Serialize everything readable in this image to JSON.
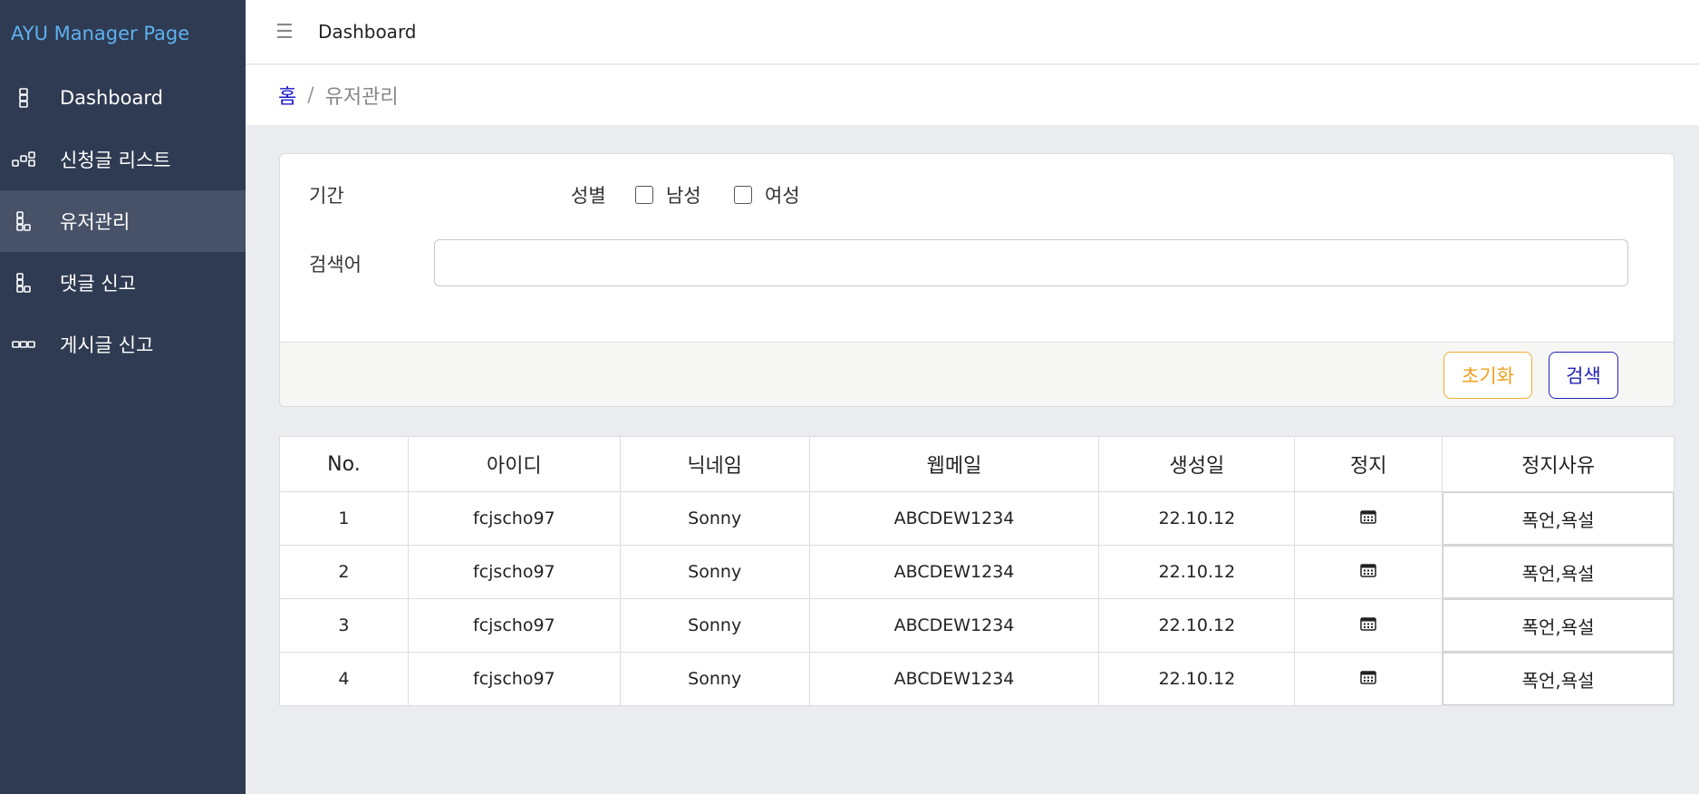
{
  "sidebar": {
    "brand": "AYU Manager Page",
    "items": [
      {
        "label": "Dashboard",
        "icon": "dashboard-icon"
      },
      {
        "label": "신청글 리스트",
        "icon": "list-icon"
      },
      {
        "label": "유저관리",
        "icon": "users-icon",
        "active": true
      },
      {
        "label": "댓글 신고",
        "icon": "report-icon"
      },
      {
        "label": "게시글 신고",
        "icon": "dots-icon"
      }
    ]
  },
  "header": {
    "title": "Dashboard",
    "menu_icon": "menu-icon"
  },
  "breadcrumb": {
    "home": "홈",
    "separator": "/",
    "current": "유저관리"
  },
  "filter": {
    "period_label": "기간",
    "gender_label": "성별",
    "male_label": "남성",
    "female_label": "여성",
    "male_checked": false,
    "female_checked": false,
    "keyword_label": "검색어",
    "keyword_value": "",
    "reset_label": "초기화",
    "search_label": "검색"
  },
  "table": {
    "columns": [
      "No.",
      "아이디",
      "닉네임",
      "웹메일",
      "생성일",
      "정지",
      "정지사유"
    ],
    "rows": [
      {
        "no": "1",
        "id": "fcjscho97",
        "nickname": "Sonny",
        "webmail": "ABCDEW1234",
        "created": "22.10.12",
        "suspend_icon": "calendar-icon",
        "reason": "폭언,욕설"
      },
      {
        "no": "2",
        "id": "fcjscho97",
        "nickname": "Sonny",
        "webmail": "ABCDEW1234",
        "created": "22.10.12",
        "suspend_icon": "calendar-icon",
        "reason": "폭언,욕설"
      },
      {
        "no": "3",
        "id": "fcjscho97",
        "nickname": "Sonny",
        "webmail": "ABCDEW1234",
        "created": "22.10.12",
        "suspend_icon": "calendar-icon",
        "reason": "폭언,욕설"
      },
      {
        "no": "4",
        "id": "fcjscho97",
        "nickname": "Sonny",
        "webmail": "ABCDEW1234",
        "created": "22.10.12",
        "suspend_icon": "calendar-icon",
        "reason": "폭언,욕설"
      }
    ]
  },
  "colors": {
    "sidebar_bg": "#2f3b52",
    "sidebar_active": "#475269",
    "brand": "#5fb1f0",
    "reset_accent": "#f0ad2e",
    "search_accent": "#2222bb",
    "breadcrumb_link": "#1a1acc"
  }
}
